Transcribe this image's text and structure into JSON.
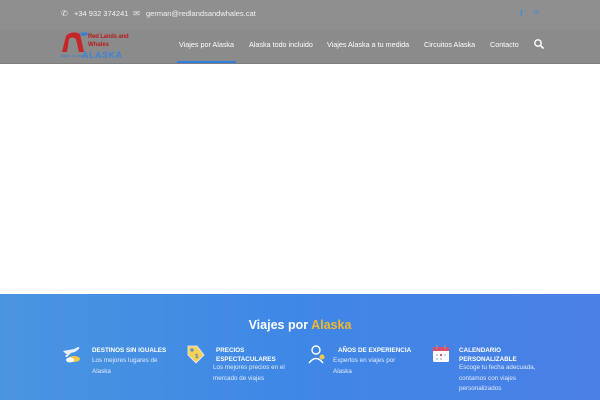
{
  "topbar": {
    "phone_icon": "phone-icon",
    "phone": "+34 932 374241",
    "email_icon": "envelope-icon",
    "email": "german@redlandsandwhales.cat",
    "social": [
      "facebook-icon",
      "linkedin-icon"
    ]
  },
  "logo": {
    "line1": "Red Lands and",
    "line2": "Whales",
    "tagline": "viajes en autor",
    "alaska": "ALASKA"
  },
  "nav": {
    "items": [
      {
        "label": "Viajes por Alaska",
        "active": true
      },
      {
        "label": "Alaska todo incluido"
      },
      {
        "label": "Viajes Alaska a tu medida"
      },
      {
        "label": "Circuitos Alaska"
      },
      {
        "label": "Contacto"
      }
    ],
    "search_icon": "search-icon"
  },
  "band": {
    "title_prefix": "Viajes por",
    "title_accent": "Alaska",
    "accent_color": "#f2b72d",
    "features": [
      {
        "icon": "plane-clouds-icon",
        "title": "DESTINOS SIN IGUALES",
        "desc": "Los mejores lugares de Alaska"
      },
      {
        "icon": "price-tag-icon",
        "title": "PRECIOS ESPECTACULARES",
        "desc": "Los mejores precios en el mercado de viajes"
      },
      {
        "icon": "expert-person-icon",
        "title": "AÑOS DE EXPERIENCIA",
        "desc": "Expertos en viajes por Alaska"
      },
      {
        "icon": "calendar-icon",
        "title": "CALENDARIO PERSONALIZABLE",
        "desc": "Escoge tu fecha adecuada, contamos con viajes personalizados"
      }
    ]
  }
}
